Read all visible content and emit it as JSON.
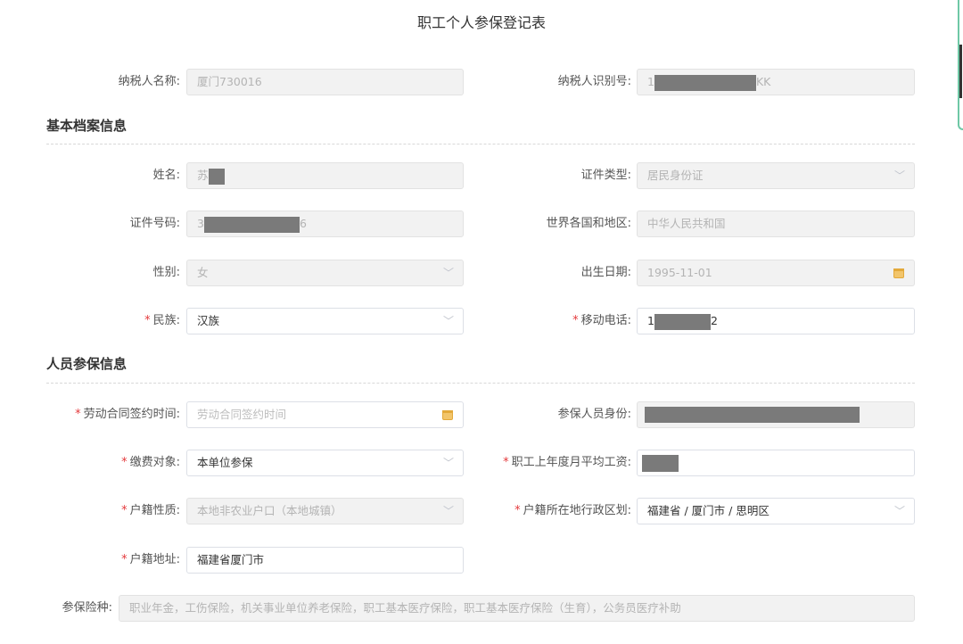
{
  "title": "职工个人参保登记表",
  "top": {
    "taxpayer_name_label": "纳税人名称:",
    "taxpayer_name_value": "厦门730016",
    "taxpayer_id_label": "纳税人识别号:",
    "taxpayer_id_prefix": "1",
    "taxpayer_id_suffix": "KK"
  },
  "basic": {
    "section_title": "基本档案信息",
    "name_label": "姓名:",
    "name_prefix": "苏",
    "id_type_label": "证件类型:",
    "id_type_value": "居民身份证",
    "id_no_label": "证件号码:",
    "id_no_prefix": "3",
    "id_no_suffix": "6",
    "region_label": "世界各国和地区:",
    "region_value": "中华人民共和国",
    "gender_label": "性别:",
    "gender_value": "女",
    "birth_label": "出生日期:",
    "birth_value": "1995-11-01",
    "ethnicity_label": "民族:",
    "ethnicity_value": "汉族",
    "mobile_label": "移动电话:",
    "mobile_prefix": "1",
    "mobile_suffix": "2"
  },
  "insured": {
    "section_title": "人员参保信息",
    "contract_label": "劳动合同签约时间:",
    "contract_placeholder": "劳动合同签约时间",
    "identity_label": "参保人员身份:",
    "payer_label": "缴费对象:",
    "payer_value": "本单位参保",
    "salary_label": "职工上年度月平均工资:",
    "hukou_type_label": "户籍性质:",
    "hukou_type_value": "本地非农业户口（本地城镇）",
    "hukou_region_label": "户籍所在地行政区划:",
    "hukou_region_value": "福建省 / 厦门市 / 思明区",
    "hukou_addr_label": "户籍地址:",
    "hukou_addr_value": "福建省厦门市",
    "insurance_types_label": "参保险种:",
    "insurance_types_value": "职业年金，工伤保险，机关事业单位养老保险，职工基本医疗保险，职工基本医疗保险（生育），公务员医疗补助"
  },
  "required_mark": "*",
  "icons": {
    "dropdown": "chevron-down-icon",
    "date": "calendar-icon"
  },
  "colors": {
    "required": "#e4393c",
    "calendar": "#f2c56b",
    "mask": "#7a7a7a",
    "accent": "#6fc8a6"
  }
}
